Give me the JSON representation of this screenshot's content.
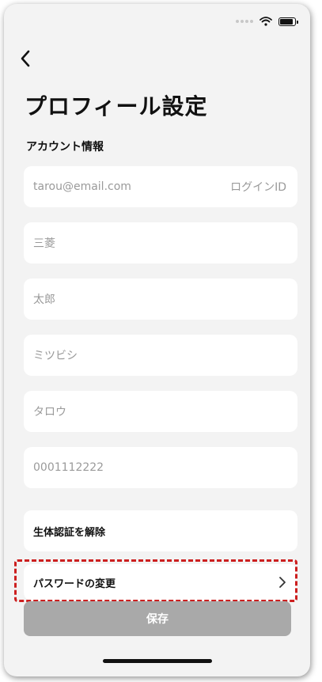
{
  "header": {
    "title": "プロフィール設定",
    "back_icon": "chevron-left-icon"
  },
  "status_bar": {
    "icons": [
      "signal-dots-icon",
      "wifi-icon",
      "battery-icon"
    ]
  },
  "account": {
    "section_label": "アカウント情報",
    "fields": [
      {
        "value": "tarou@email.com",
        "suffix": "ログインID"
      },
      {
        "value": "三菱"
      },
      {
        "value": "太郎"
      },
      {
        "value": "ミツビシ"
      },
      {
        "value": "タロウ"
      },
      {
        "value": "0001112222"
      }
    ]
  },
  "actions": {
    "biometric_label": "生体認証を解除",
    "password_label": "パスワードの変更",
    "save_label": "保存"
  },
  "colors": {
    "background": "#f3f3f3",
    "card": "#ffffff",
    "highlight_border": "#cc1f1f",
    "save_button": "#a9a9a9",
    "placeholder_text": "#9a9a9a"
  }
}
